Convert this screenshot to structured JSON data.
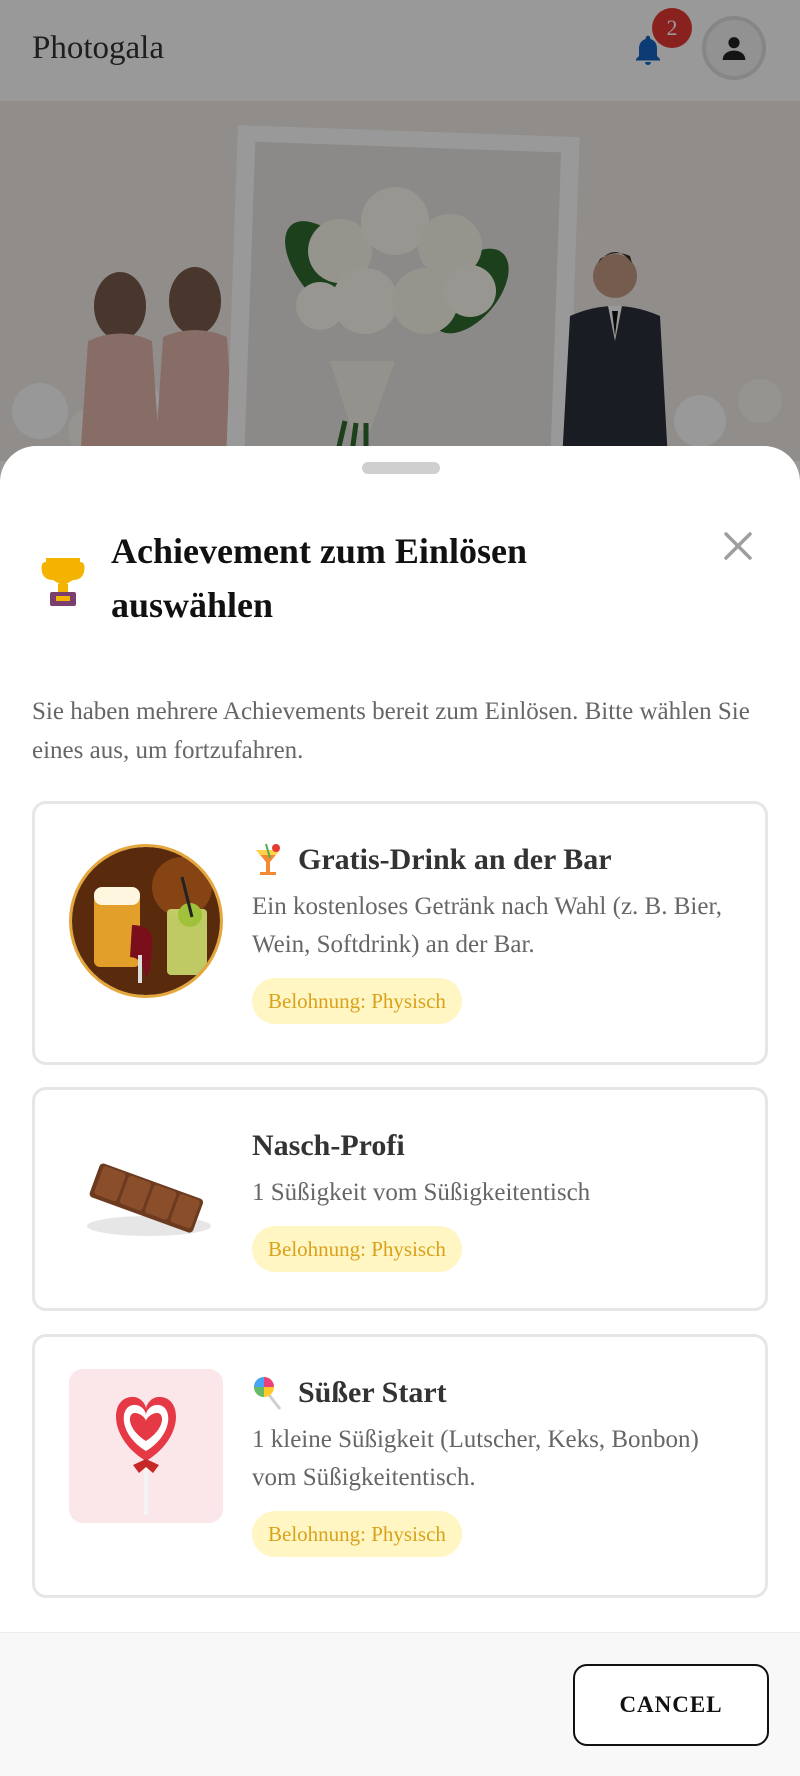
{
  "app": {
    "title": "Photogala",
    "notification_count": "2"
  },
  "sheet": {
    "title": "Achievement zum Einlösen auswählen",
    "description": "Sie haben mehrere Achievements bereit zum Einlösen. Bitte wählen Sie eines aus, um fortzufahren.",
    "achievements": [
      {
        "title": "Gratis-Drink an der Bar",
        "description": "Ein kostenloses Getränk nach Wahl (z. B. Bier, Wein, Softdrink) an der Bar.",
        "badge": "Belohnung: Physisch",
        "icon": "cocktail-icon"
      },
      {
        "title": "Nasch-Profi",
        "description": "1 Süßigkeit vom Süßigkeitentisch",
        "badge": "Belohnung: Physisch",
        "icon": ""
      },
      {
        "title": "Süßer Start",
        "description": "1 kleine Süßigkeit (Lutscher, Keks, Bonbon) vom Süßigkeitentisch.",
        "badge": "Belohnung: Physisch",
        "icon": "lollipop-icon"
      }
    ],
    "cancel_label": "CANCEL"
  },
  "colors": {
    "badge_bg": "#fff6c4",
    "badge_text": "#d9a21a",
    "notification": "#e53935",
    "bell": "#1565c0"
  }
}
